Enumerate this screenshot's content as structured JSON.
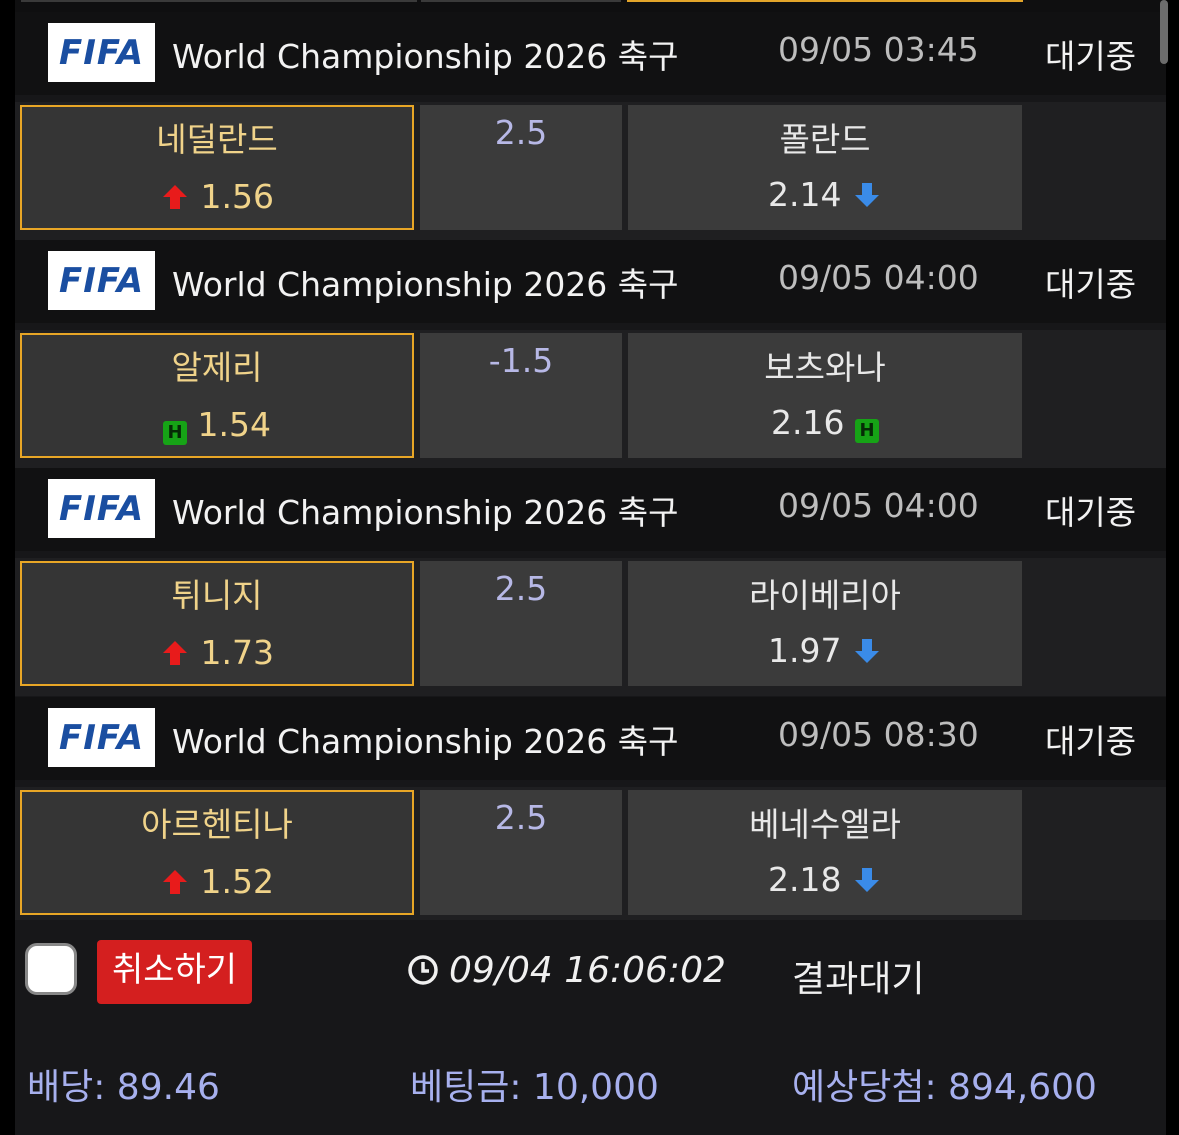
{
  "matches": [
    {
      "logo_text": "FIFA",
      "league": "World Championship 2026 축구",
      "time": "09/05 03:45",
      "status": "대기중",
      "home": {
        "name": "네덜란드",
        "odd": "1.56",
        "trend": "up"
      },
      "line": "2.5",
      "away": {
        "name": "폴란드",
        "odd": "2.14",
        "trend": "down"
      }
    },
    {
      "logo_text": "FIFA",
      "league": "World Championship 2026 축구",
      "time": "09/05 04:00",
      "status": "대기중",
      "home": {
        "name": "알제리",
        "odd": "1.54",
        "trend": "handicap",
        "badge": "H"
      },
      "line": "-1.5",
      "away": {
        "name": "보츠와나",
        "odd": "2.16",
        "trend": "handicap",
        "badge": "H"
      }
    },
    {
      "logo_text": "FIFA",
      "league": "World Championship 2026 축구",
      "time": "09/05 04:00",
      "status": "대기중",
      "home": {
        "name": "튀니지",
        "odd": "1.73",
        "trend": "up"
      },
      "line": "2.5",
      "away": {
        "name": "라이베리아",
        "odd": "1.97",
        "trend": "down"
      }
    },
    {
      "logo_text": "FIFA",
      "league": "World Championship 2026 축구",
      "time": "09/05 08:30",
      "status": "대기중",
      "home": {
        "name": "아르헨티나",
        "odd": "1.52",
        "trend": "up"
      },
      "line": "2.5",
      "away": {
        "name": "베네수엘라",
        "odd": "2.18",
        "trend": "down"
      }
    }
  ],
  "footer": {
    "cancel_label": "취소하기",
    "bet_time": "09/04 16:06:02",
    "result_status": "결과대기",
    "total_odds": "배당: 89.46",
    "bet_amount": "베팅금: 10,000",
    "expected_win": "예상당첨: 894,600"
  },
  "colors": {
    "selected_border": "#e8a626",
    "up_arrow": "#e81b1b",
    "down_arrow": "#3a8be8",
    "handicap_badge": "#16a316",
    "cancel_button": "#d41f1f",
    "summary_text": "#a7b0ee"
  }
}
